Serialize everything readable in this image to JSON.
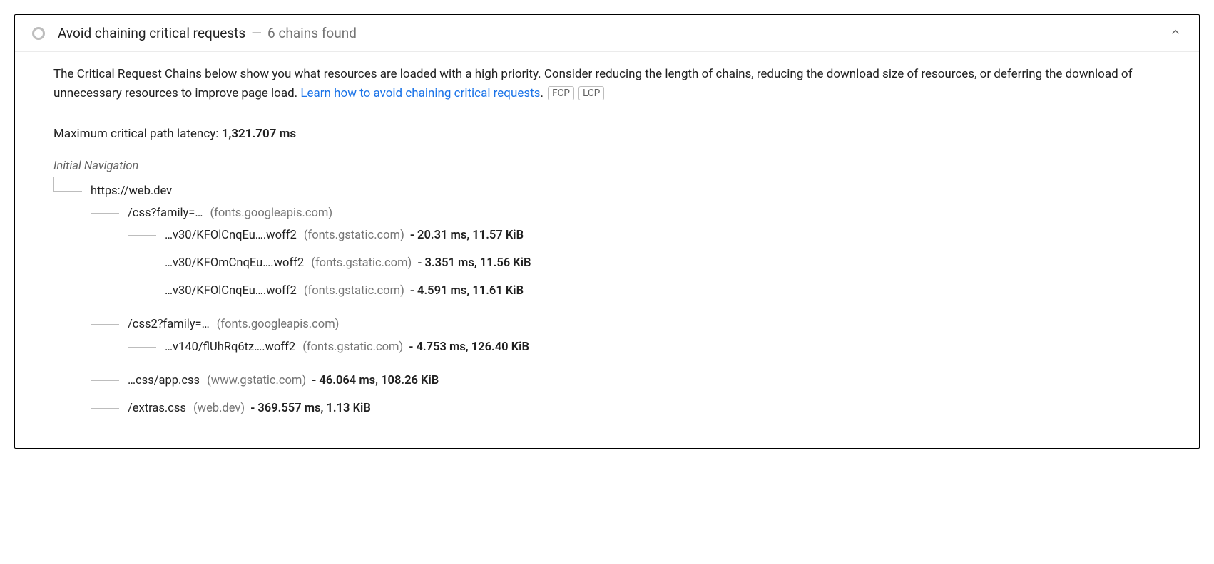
{
  "header": {
    "title": "Avoid chaining critical requests",
    "separator": "—",
    "subtitle": "6 chains found"
  },
  "description": {
    "text_before_link": "The Critical Request Chains below show you what resources are loaded with a high priority. Consider reducing the length of chains, reducing the download size of resources, or deferring the download of unnecessary resources to improve page load. ",
    "link_text": "Learn how to avoid chaining critical requests",
    "text_after_link": "."
  },
  "tags": {
    "fcp": "FCP",
    "lcp": "LCP"
  },
  "latency": {
    "label": "Maximum critical path latency: ",
    "value": "1,321.707 ms"
  },
  "tree": {
    "root_label": "Initial Navigation",
    "root_url": "https://web.dev",
    "children": [
      {
        "path": "/css?family=…",
        "origin": "(fonts.googleapis.com)",
        "stats": "",
        "children": [
          {
            "path": "…v30/KFOlCnqEu….woff2",
            "origin": "(fonts.gstatic.com)",
            "stats": "- 20.31 ms, 11.57 KiB"
          },
          {
            "path": "…v30/KFOmCnqEu….woff2",
            "origin": "(fonts.gstatic.com)",
            "stats": "- 3.351 ms, 11.56 KiB"
          },
          {
            "path": "…v30/KFOlCnqEu….woff2",
            "origin": "(fonts.gstatic.com)",
            "stats": "- 4.591 ms, 11.61 KiB"
          }
        ]
      },
      {
        "path": "/css2?family=…",
        "origin": "(fonts.googleapis.com)",
        "stats": "",
        "children": [
          {
            "path": "…v140/flUhRq6tz….woff2",
            "origin": "(fonts.gstatic.com)",
            "stats": "- 4.753 ms, 126.40 KiB"
          }
        ]
      },
      {
        "path": "…css/app.css",
        "origin": "(www.gstatic.com)",
        "stats": "- 46.064 ms, 108.26 KiB"
      },
      {
        "path": "/extras.css",
        "origin": "(web.dev)",
        "stats": "- 369.557 ms, 1.13 KiB"
      }
    ]
  }
}
